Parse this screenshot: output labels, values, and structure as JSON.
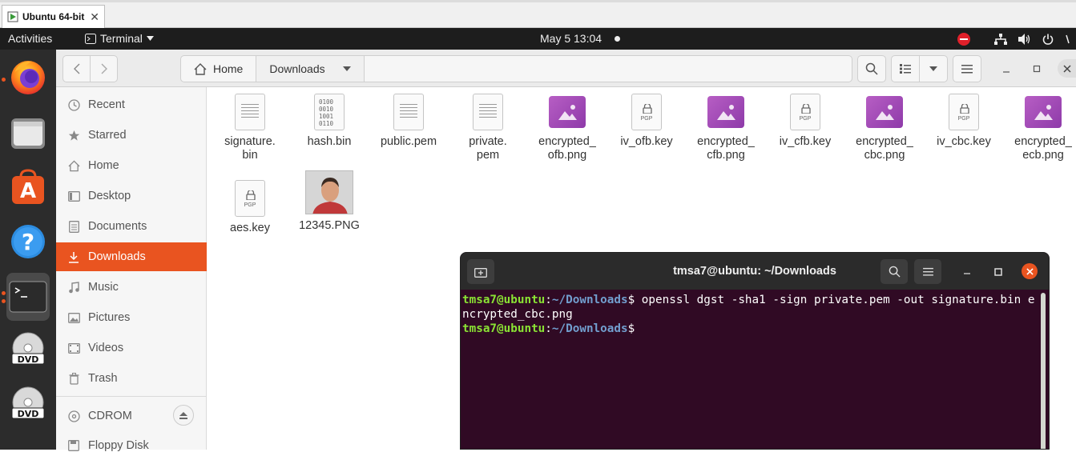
{
  "vm_tab": {
    "title": "Ubuntu 64-bit",
    "close": "✕"
  },
  "topbar": {
    "activities": "Activities",
    "app_menu": "Terminal",
    "clock": "May 5  13:04"
  },
  "dock": {
    "items": [
      "firefox-icon",
      "files-icon",
      "software-icon",
      "help-icon",
      "terminal-icon",
      "dvd-icon",
      "dvd-icon"
    ]
  },
  "nautilus": {
    "path": {
      "home": "Home",
      "current": "Downloads"
    },
    "sidebar": {
      "items": [
        {
          "label": "Recent",
          "icon": "clock-icon"
        },
        {
          "label": "Starred",
          "icon": "star-icon"
        },
        {
          "label": "Home",
          "icon": "home-icon"
        },
        {
          "label": "Desktop",
          "icon": "desktop-icon"
        },
        {
          "label": "Documents",
          "icon": "document-icon"
        },
        {
          "label": "Downloads",
          "icon": "download-icon",
          "selected": true
        },
        {
          "label": "Music",
          "icon": "music-icon"
        },
        {
          "label": "Pictures",
          "icon": "pictures-icon"
        },
        {
          "label": "Videos",
          "icon": "videos-icon"
        },
        {
          "label": "Trash",
          "icon": "trash-icon"
        },
        {
          "label": "CDROM",
          "icon": "disc-icon"
        },
        {
          "label": "Floppy Disk",
          "icon": "floppy-icon"
        }
      ]
    },
    "files": [
      {
        "name": "signature.\nbin",
        "kind": "text"
      },
      {
        "name": "hash.bin",
        "kind": "binary"
      },
      {
        "name": "public.pem",
        "kind": "text"
      },
      {
        "name": "private.\npem",
        "kind": "text"
      },
      {
        "name": "encrypted_\nofb.png",
        "kind": "image"
      },
      {
        "name": "iv_ofb.key",
        "kind": "pgp"
      },
      {
        "name": "encrypted_\ncfb.png",
        "kind": "image"
      },
      {
        "name": "iv_cfb.key",
        "kind": "pgp"
      },
      {
        "name": "encrypted_\ncbc.png",
        "kind": "image"
      },
      {
        "name": "iv_cbc.key",
        "kind": "pgp"
      },
      {
        "name": "encrypted_\necb.png",
        "kind": "image"
      },
      {
        "name": "aes.key",
        "kind": "pgp"
      },
      {
        "name": "12345.PNG",
        "kind": "photo"
      }
    ],
    "binary_preview": "0100\n0010\n1001\n0110",
    "pgp_label": "PGP"
  },
  "terminal": {
    "title": "tmsa7@ubuntu: ~/Downloads",
    "lines": [
      {
        "user": "tmsa7@ubuntu",
        "path": "~/Downloads",
        "cmd": " openssl dgst -sha1 -sign private.pem -out signature.bin encrypted_cbc.png"
      },
      {
        "user": "tmsa7@ubuntu",
        "path": "~/Downloads",
        "cmd": ""
      }
    ]
  },
  "colors": {
    "accent": "#e95420",
    "terminal_bg": "#300a24",
    "prompt_user": "#8ae234",
    "prompt_path": "#729fcf"
  }
}
